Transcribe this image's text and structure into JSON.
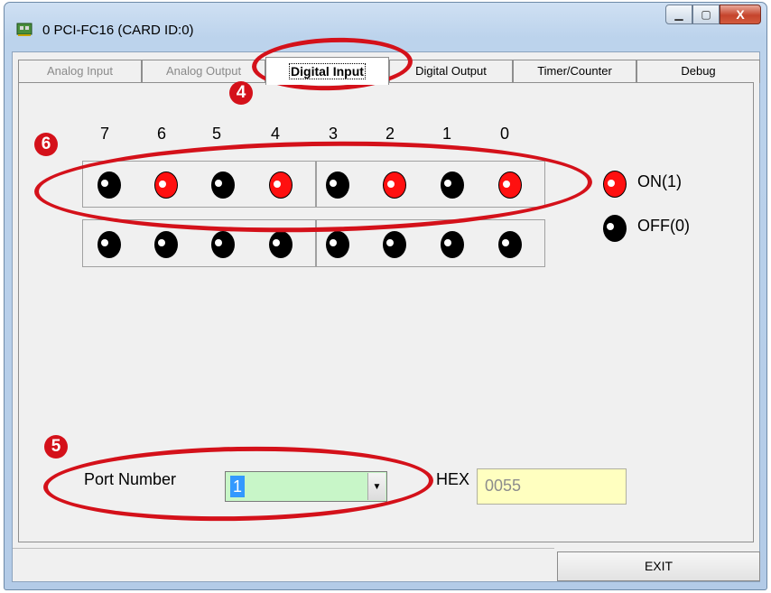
{
  "window": {
    "title": "0 PCI-FC16 (CARD ID:0)",
    "minimize_glyph": "▁",
    "maximize_glyph": "▢",
    "close_glyph": "X"
  },
  "tabs": [
    {
      "label": "Analog Input",
      "state": "disabled"
    },
    {
      "label": "Analog Output",
      "state": "disabled"
    },
    {
      "label": "Digital Input",
      "state": "active"
    },
    {
      "label": "Digital Output",
      "state": "normal"
    },
    {
      "label": "Timer/Counter",
      "state": "normal"
    },
    {
      "label": "Debug",
      "state": "normal"
    }
  ],
  "bit_labels": [
    "7",
    "6",
    "5",
    "4",
    "3",
    "2",
    "1",
    "0"
  ],
  "leds": {
    "row1": [
      "off",
      "on",
      "off",
      "on",
      "off",
      "on",
      "off",
      "on"
    ],
    "row2": [
      "off",
      "off",
      "off",
      "off",
      "off",
      "off",
      "off",
      "off"
    ]
  },
  "legend": {
    "on_label": "ON(1)",
    "off_label": "OFF(0)"
  },
  "port": {
    "label": "Port Number",
    "value": "1",
    "dropdown_icon": "chevron-down-icon"
  },
  "hex": {
    "label": "HEX",
    "value": "0055"
  },
  "exit_button": {
    "label": "EXIT"
  },
  "annotations": {
    "badge_4": "4",
    "badge_5": "5",
    "badge_6": "6"
  },
  "colors": {
    "led_on": "#ff1010",
    "led_off": "#000000",
    "annotation_red": "#d4111a",
    "port_field": "#c8f6c8",
    "hex_field": "#ffffc0"
  }
}
